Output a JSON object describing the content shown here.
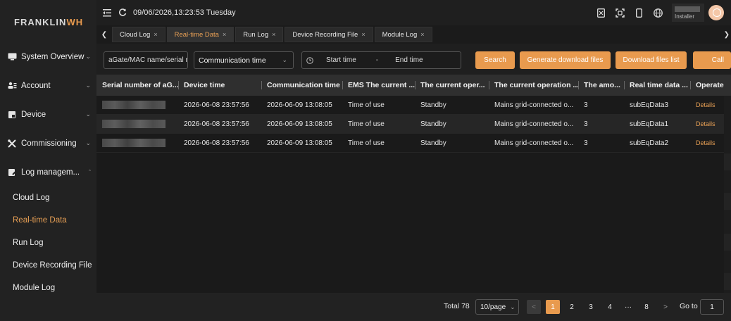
{
  "brand": {
    "part1": "FRANKLIN",
    "part2": "WH"
  },
  "header": {
    "datetime": "09/06/2026,13:23:53 Tuesday",
    "role": "Installer",
    "icons": [
      "menu-fold-icon",
      "refresh-icon",
      "document-icon",
      "fullscreen-icon",
      "mobile-icon",
      "globe-icon"
    ]
  },
  "sidebar": {
    "groups": [
      {
        "label": "System Overview",
        "icon": "monitor-icon"
      },
      {
        "label": "Account",
        "icon": "users-icon"
      },
      {
        "label": "Device",
        "icon": "device-icon"
      },
      {
        "label": "Commissioning",
        "icon": "tools-icon"
      },
      {
        "label": "Log managem...",
        "icon": "log-icon"
      }
    ],
    "sub_items": [
      "Cloud Log",
      "Real-time Data",
      "Run Log",
      "Device Recording File",
      "Module Log"
    ],
    "active_sub": "Real-time Data"
  },
  "tabs": [
    {
      "label": "Cloud Log",
      "close": "×"
    },
    {
      "label": "Real-time Data",
      "close": "×"
    },
    {
      "label": "Run Log",
      "close": "×"
    },
    {
      "label": "Device Recording File",
      "close": "×"
    },
    {
      "label": "Module Log",
      "close": "×"
    }
  ],
  "filter": {
    "search_placeholder": "aGate/MAC name/serial nu",
    "time_type": "Communication time",
    "start_time": "Start time",
    "separator": "-",
    "end_time": "End time",
    "search_button": "Search",
    "generate_button": "Generate download files",
    "download_list_button": "Download files list",
    "call_button": "Call"
  },
  "table": {
    "columns": [
      "Serial number of aG...",
      "Device time",
      "Communication time",
      "EMS The current ...",
      "The current oper...",
      "The current operation ...",
      "The amo...",
      "Real time data ...",
      "Operate"
    ],
    "rows": [
      {
        "device_time": "2026-06-08 23:57:56",
        "comm_time": "2026-06-09 13:08:05",
        "ems": "Time of use",
        "oper": "Standby",
        "operation": "Mains grid-connected o...",
        "amount": "3",
        "realtime": "subEqData3",
        "action": "Details"
      },
      {
        "device_time": "2026-06-08 23:57:56",
        "comm_time": "2026-06-09 13:08:05",
        "ems": "Time of use",
        "oper": "Standby",
        "operation": "Mains grid-connected o...",
        "amount": "3",
        "realtime": "subEqData1",
        "action": "Details"
      },
      {
        "device_time": "2026-06-08 23:57:56",
        "comm_time": "2026-06-09 13:08:05",
        "ems": "Time of use",
        "oper": "Standby",
        "operation": "Mains grid-connected o...",
        "amount": "3",
        "realtime": "subEqData2",
        "action": "Details"
      }
    ]
  },
  "pagination": {
    "total": "Total 78",
    "page_size": "10/page",
    "prev": "<",
    "pages": [
      "1",
      "2",
      "3",
      "4",
      "···",
      "8"
    ],
    "next": ">",
    "goto_label": "Go to",
    "goto_value": "1",
    "current_page": 1
  },
  "colors": {
    "accent": "#e89a4e",
    "background": "#1a1a1a",
    "sidebar": "#222222"
  }
}
